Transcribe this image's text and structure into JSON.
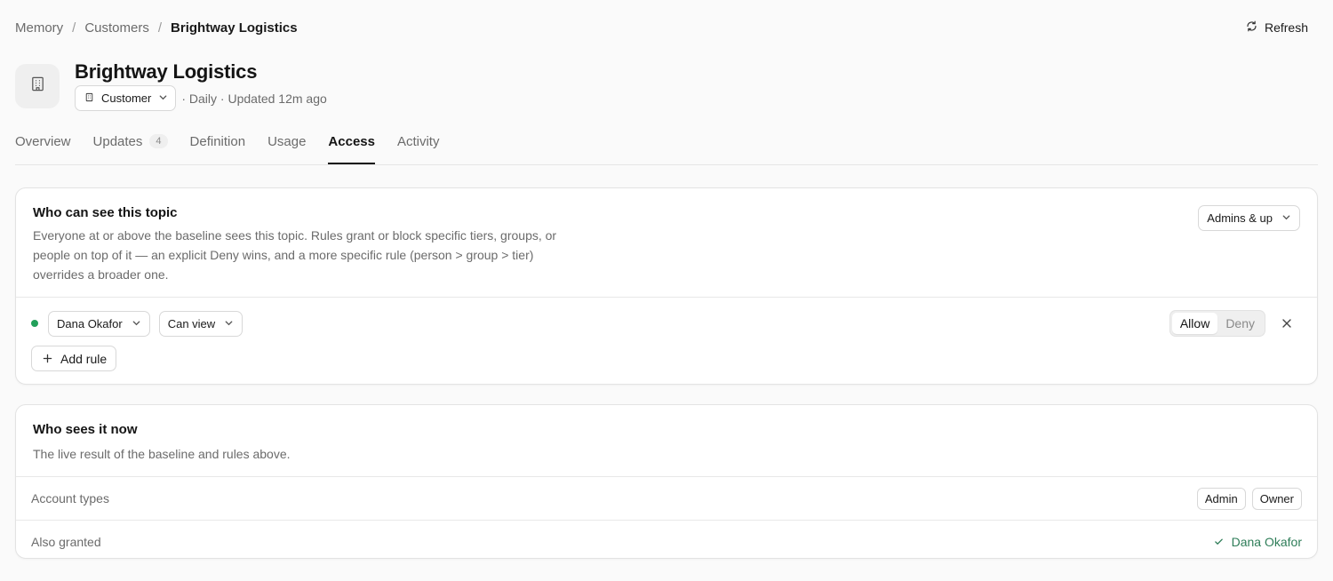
{
  "breadcrumb": {
    "items": [
      "Memory",
      "Customers"
    ],
    "current": "Brightway Logistics",
    "separator": "/"
  },
  "toolbar": {
    "refresh_label": "Refresh"
  },
  "header": {
    "title": "Brightway Logistics",
    "type_label": "Customer",
    "meta": "· Daily · Updated 12m ago"
  },
  "tabs": [
    {
      "label": "Overview"
    },
    {
      "label": "Updates",
      "badge": "4"
    },
    {
      "label": "Definition"
    },
    {
      "label": "Usage"
    },
    {
      "label": "Access",
      "active": true
    },
    {
      "label": "Activity"
    }
  ],
  "visibility": {
    "title": "Who can see this topic",
    "description": "Everyone at or above the baseline sees this topic. Rules grant or block specific tiers, groups, or people on top of it — an explicit Deny wins, and a more specific rule (person > group > tier) overrides a broader one.",
    "baseline": "Admins & up",
    "rule": {
      "subject": "Dana Okafor",
      "permission": "Can view",
      "allow_label": "Allow",
      "deny_label": "Deny",
      "status_color": "#22a05a"
    },
    "add_rule_label": "Add rule"
  },
  "result": {
    "title": "Who sees it now",
    "description": "The live result of the baseline and rules above.",
    "account_types_label": "Account types",
    "account_types": [
      "Admin",
      "Owner"
    ],
    "also_granted_label": "Also granted",
    "also_granted": "Dana Okafor",
    "granted_color": "#2e7d58"
  }
}
